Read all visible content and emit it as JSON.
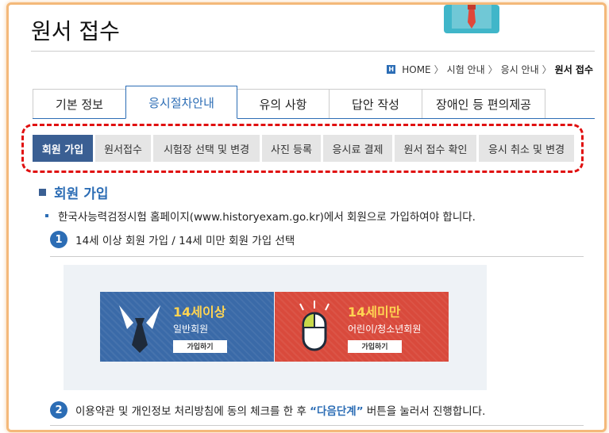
{
  "page": {
    "title": "원서 접수"
  },
  "breadcrumb": {
    "home_icon_letter": "H",
    "items": [
      "HOME",
      "시험 안내",
      "응시 안내",
      "원서 접수"
    ],
    "separator": "〉"
  },
  "tabs": [
    {
      "label": "기본 정보",
      "active": false
    },
    {
      "label": "응시절차안내",
      "active": true
    },
    {
      "label": "유의 사항",
      "active": false
    },
    {
      "label": "답안 작성",
      "active": false
    },
    {
      "label": "장애인 등 편의제공",
      "active": false
    }
  ],
  "subnav": [
    {
      "label": "회원 가입",
      "active": true
    },
    {
      "label": "원서접수",
      "active": false
    },
    {
      "label": "시험장 선택 및 변경",
      "active": false
    },
    {
      "label": "사진 등록",
      "active": false
    },
    {
      "label": "응시료 결제",
      "active": false
    },
    {
      "label": "원서 접수 확인",
      "active": false
    },
    {
      "label": "응시 취소 및 변경",
      "active": false
    }
  ],
  "section": {
    "title": "회원 가입",
    "intro": "한국사능력검정시험 홈페이지(www.historyexam.go.kr)에서 회원으로 가입하여야 합니다."
  },
  "steps": [
    {
      "num": "1",
      "text": "14세 이상 회원 가입 / 14세 미만 회원 가입 선택"
    },
    {
      "num": "2",
      "text_before": "이용약관 및 개인정보 처리방침에 동의 체크를 한 후 ",
      "highlight": "“다음단계”",
      "text_after": " 버튼을 눌러서 진행합니다."
    }
  ],
  "join_cards": {
    "adult": {
      "age": "14세이상",
      "type": "일반회원",
      "button": "가입하기",
      "color": "#3a6aa8"
    },
    "child": {
      "age": "14세미만",
      "type": "어린이/청소년회원",
      "button": "가입하기",
      "color": "#d94a3c"
    }
  },
  "colors": {
    "accent": "#2c6db5",
    "subnav_active": "#3a5f93",
    "highlight_border": "#e01010",
    "frame_border": "#f4b97a",
    "age_text": "#ffd452"
  },
  "icons": {
    "home": "home-icon",
    "adult_card": "necktie-icon",
    "child_card": "mouse-icon"
  }
}
